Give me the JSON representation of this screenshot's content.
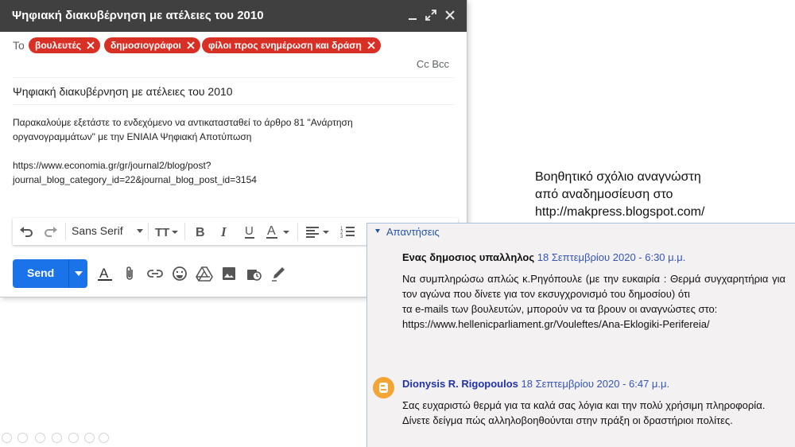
{
  "compose": {
    "title": "Ψηφιακή διακυβέρνηση με ατέλειες του 2010",
    "to_label": "To",
    "recipients": [
      "βουλευτές",
      "δημοσιογράφοι",
      "φίλοι προς ενημέρωση και δράση"
    ],
    "cc_bcc": "Cc Bcc",
    "subject": "Ψηφιακή διακυβέρνηση με ατέλειες του 2010",
    "body_line1": "Παρακαλούμε εξετάστε το ενδεχόμενο να αντικατασταθεί το άρθρο 81 \"Ανάρτηση",
    "body_line2": "οργανογραμμάτων\" με την ΕΝΙΑΙΑ Ψηφιακή Αποτύπωση",
    "body_url1": "https://www.economia.gr/gr/journal2/blog/post?",
    "body_url2": "journal_blog_category_id=22&journal_blog_post_id=3154",
    "font": "Sans Serif",
    "send": "Send",
    "header_color": "#404040",
    "send_color": "#1a73e8",
    "chip_color": "#d93025"
  },
  "annotation": {
    "line1": "Βοηθητικό σχόλιο αναγνώστη",
    "line2": "από αναδημοσίευση στο",
    "line3": "http://makpress.blogspot.com/"
  },
  "replies": {
    "heading": "Απαντήσεις",
    "comments": [
      {
        "author": "Ενας δημοσιος υπαλληλος",
        "date": "18 Σεπτεμβρίου 2020 - 6:30 μ.μ.",
        "text1": "Να συμπληρώσω απλώς κ.Ρηγόπουλε (με την ευκαιρία : Θερμά συγχαρητήρια για τον αγώνα που δίνετε για τον εκσυγχρονισμό του δημοσίου) ότι",
        "text2": "τα e-mails των βουλευτών, μπορούν να τα βρουν οι αναγνώστες στο:",
        "text3": "https://www.hellenicparliament.gr/Vouleftes/Ana-Eklogiki-Perifereia/"
      },
      {
        "author": "Dionysis R. Rigopoulos",
        "date": "18 Σεπτεμβρίου 2020 - 6:47 μ.μ.",
        "text1": "Σας ευχαριστώ θερμά για τα καλά σας λόγια και την πολύ χρήσιμη πληροφορία.",
        "text2": "Δίνετε δείγμα πώς αλληλοβοηθούνται στην πράξη οι δραστήριοι πολίτες."
      }
    ]
  }
}
